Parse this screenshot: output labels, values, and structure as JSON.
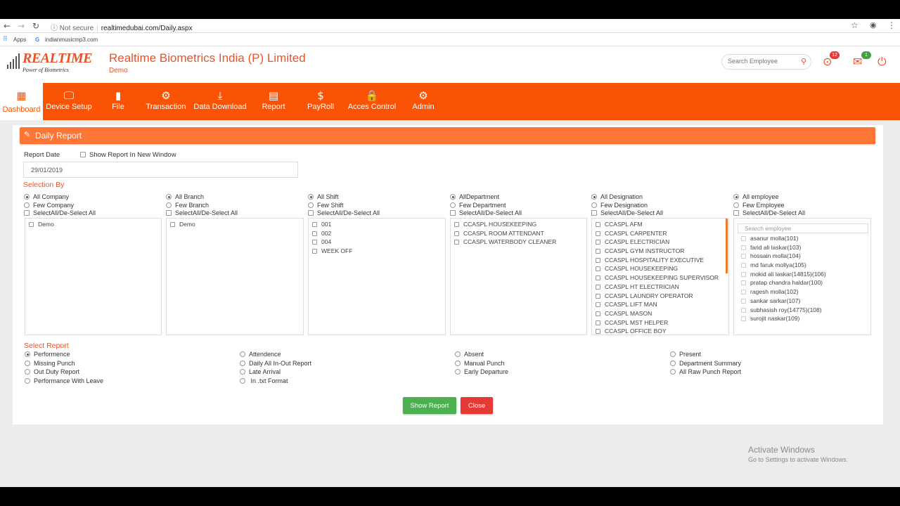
{
  "browser": {
    "security": "Not secure",
    "url": "realtimedubai.com/Daily.aspx",
    "bookmarks": [
      "Apps",
      "indianmusicmp3.com"
    ]
  },
  "header": {
    "logo_brand": "REALTIME",
    "logo_tagline": "Power of Biometrics",
    "company": "Realtime Biometrics India (P) Limited",
    "subtitle": "Demo",
    "search_placeholder": "Search Employee",
    "location_badge": "12",
    "mail_badge": "1"
  },
  "nav": [
    {
      "label": "Dashboard",
      "icon": "dashboard-icon",
      "glyph": "▦"
    },
    {
      "label": "Device Setup",
      "icon": "monitor-icon",
      "glyph": "🖵"
    },
    {
      "label": "File",
      "icon": "file-icon",
      "glyph": "▮"
    },
    {
      "label": "Transaction",
      "icon": "gear-icon",
      "glyph": "⚙"
    },
    {
      "label": "Data Download",
      "icon": "download-icon",
      "glyph": "⤓"
    },
    {
      "label": "Report",
      "icon": "calendar-icon",
      "glyph": "▤"
    },
    {
      "label": "PayRoll",
      "icon": "money-icon",
      "glyph": "$"
    },
    {
      "label": "Acces Control",
      "icon": "lock-icon",
      "glyph": "🔒"
    },
    {
      "label": "Admin",
      "icon": "gears-icon",
      "glyph": "⚙"
    }
  ],
  "panel": {
    "title": "Daily Report",
    "report_date_label": "Report Date",
    "new_window_label": "Show Report In New Window",
    "report_date_value": "29/01/2019",
    "selection_title": "Selection By",
    "report_title": "Select Report"
  },
  "selection": [
    {
      "all": "All Company",
      "few": "Few Company",
      "selectall": "SelectAll/De-Select All",
      "items": [
        "Demo"
      ]
    },
    {
      "all": "All Branch",
      "few": "Few Branch",
      "selectall": "SelectAll/De-Select All",
      "items": [
        "Demo"
      ]
    },
    {
      "all": "All Shift",
      "few": "Few Shift",
      "selectall": "SelectAll/De-Select All",
      "items": [
        "001",
        "002",
        "004",
        "WEEK OFF"
      ]
    },
    {
      "all": "AllDepartment",
      "few": "Few Department",
      "selectall": "SelectAll/De-Select All",
      "items": [
        "CCASPL HOUSEKEEPING",
        "CCASPL ROOM ATTENDANT",
        "CCASPL WATERBODY CLEANER"
      ]
    },
    {
      "all": "All Designation",
      "few": "Few Designation",
      "selectall": "SelectAll/De-Select All",
      "items": [
        "CCASPL AFM",
        "CCASPL CARPENTER",
        "CCASPL ELECTRICIAN",
        "CCASPL GYM INSTRUCTOR",
        "CCASPL HOSPITALITY EXECUTIVE",
        "CCASPL HOUSEKEEPING",
        "CCASPL HOUSEKEEPING SUPERVISOR",
        "CCASPL HT ELECTRICIAN",
        "CCASPL LAUNDRY OPERATOR",
        "CCASPL LIFT MAN",
        "CCASPL MASON",
        "CCASPL MST HELPER",
        "CCASPL OFFICE BOY"
      ]
    },
    {
      "all": "All employee",
      "few": "Few Employee",
      "selectall": "SelectAll/De-Select All",
      "search_placeholder": "Search employee",
      "items": [
        "asanur molla(101)",
        "farid ali laskar(103)",
        "hossain molla(104)",
        "md faruk mollya(105)",
        "mokid ali laskar(14815)(106)",
        "pratap chandra haldar(100)",
        "ragesh molla(102)",
        "sankar sarkar(107)",
        "subhasish roy(14775)(108)",
        "surojit naskar(109)"
      ]
    }
  ],
  "reports": [
    [
      "Performence",
      "Missing Punch",
      "Out Duty Report",
      "Performance With Leave"
    ],
    [
      "Attendence",
      "Daily All In-Out Report",
      "Late Arrival",
      " In .txt Format"
    ],
    [
      "Absent",
      "Manual Punch",
      "Early Departure"
    ],
    [
      "Present",
      "Department Summary",
      "All Raw Punch Report"
    ]
  ],
  "buttons": {
    "show": "Show Report",
    "close": "Close"
  },
  "watermark": {
    "line1": "Activate Windows",
    "line2": "Go to Settings to activate Windows."
  },
  "colors": {
    "accent": "#fa5305",
    "header_bar": "#ff7536",
    "show_button": "#4caf50",
    "close_button": "#e53935"
  }
}
